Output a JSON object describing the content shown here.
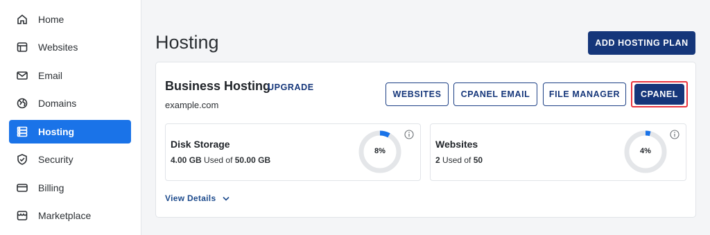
{
  "sidebar": {
    "items": [
      {
        "label": "Home",
        "icon": "home-icon"
      },
      {
        "label": "Websites",
        "icon": "browser-window-icon"
      },
      {
        "label": "Email",
        "icon": "envelope-icon"
      },
      {
        "label": "Domains",
        "icon": "globe-icon"
      },
      {
        "label": "Hosting",
        "icon": "server-icon",
        "active": true
      },
      {
        "label": "Security",
        "icon": "shield-icon"
      },
      {
        "label": "Billing",
        "icon": "credit-card-icon"
      },
      {
        "label": "Marketplace",
        "icon": "storefront-icon"
      }
    ]
  },
  "header": {
    "title": "Hosting",
    "add_plan_label": "ADD HOSTING PLAN"
  },
  "plan": {
    "name": "Business Hosting",
    "upgrade_label": "UPGRADE",
    "domain": "example.com",
    "actions": {
      "websites": "WEBSITES",
      "cpanel_email": "CPANEL EMAIL",
      "file_manager": "FILE MANAGER",
      "cpanel": "CPANEL"
    }
  },
  "stats": {
    "disk": {
      "title": "Disk Storage",
      "used": "4.00 GB",
      "used_of": "Used of",
      "total": "50.00 GB",
      "percent_label": "8%",
      "percent": 8
    },
    "websites": {
      "title": "Websites",
      "used": "2",
      "used_of": "Used of",
      "total": "50",
      "percent_label": "4%",
      "percent": 4
    }
  },
  "view_details_label": "View Details",
  "colors": {
    "primary": "#15367a",
    "accent_blue": "#1a73e8",
    "ring_track": "#e4e6e9",
    "highlight_red": "#e8333d"
  }
}
